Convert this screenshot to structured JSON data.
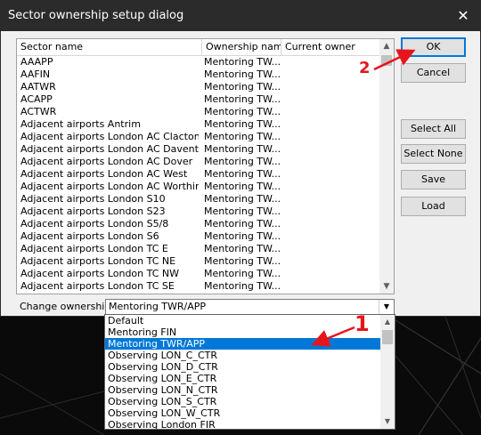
{
  "window": {
    "title": "Sector ownership setup dialog",
    "close_glyph": "✕"
  },
  "list": {
    "headers": [
      "Sector name",
      "Ownership name",
      "Current owner"
    ],
    "rows": [
      {
        "name": "AAAPP",
        "ownership": "Mentoring TW...",
        "owner": ""
      },
      {
        "name": "AAFIN",
        "ownership": "Mentoring TW...",
        "owner": ""
      },
      {
        "name": "AATWR",
        "ownership": "Mentoring TW...",
        "owner": ""
      },
      {
        "name": "ACAPP",
        "ownership": "Mentoring TW...",
        "owner": ""
      },
      {
        "name": "ACTWR",
        "ownership": "Mentoring TW...",
        "owner": ""
      },
      {
        "name": "Adjacent airports Antrim",
        "ownership": "Mentoring TW...",
        "owner": ""
      },
      {
        "name": "Adjacent airports London AC Clacton",
        "ownership": "Mentoring TW...",
        "owner": ""
      },
      {
        "name": "Adjacent airports London AC Daventry",
        "ownership": "Mentoring TW...",
        "owner": ""
      },
      {
        "name": "Adjacent airports London AC Dover",
        "ownership": "Mentoring TW...",
        "owner": ""
      },
      {
        "name": "Adjacent airports London AC West",
        "ownership": "Mentoring TW...",
        "owner": ""
      },
      {
        "name": "Adjacent airports London AC Worthing",
        "ownership": "Mentoring TW...",
        "owner": ""
      },
      {
        "name": "Adjacent airports London S10",
        "ownership": "Mentoring TW...",
        "owner": ""
      },
      {
        "name": "Adjacent airports London S23",
        "ownership": "Mentoring TW...",
        "owner": ""
      },
      {
        "name": "Adjacent airports London S5/8",
        "ownership": "Mentoring TW...",
        "owner": ""
      },
      {
        "name": "Adjacent airports London S6",
        "ownership": "Mentoring TW...",
        "owner": ""
      },
      {
        "name": "Adjacent airports London TC E",
        "ownership": "Mentoring TW...",
        "owner": ""
      },
      {
        "name": "Adjacent airports London TC NE",
        "ownership": "Mentoring TW...",
        "owner": ""
      },
      {
        "name": "Adjacent airports London TC NW",
        "ownership": "Mentoring TW...",
        "owner": ""
      },
      {
        "name": "Adjacent airports London TC SE",
        "ownership": "Mentoring TW...",
        "owner": ""
      }
    ]
  },
  "buttons": {
    "ok": "OK",
    "cancel": "Cancel",
    "select_all": "Select All",
    "select_none": "Select None",
    "save": "Save",
    "load": "Load"
  },
  "change_ownership": {
    "label": "Change ownership",
    "selected": "Mentoring TWR/APP",
    "options": [
      "Default",
      "Mentoring FIN",
      "Mentoring TWR/APP",
      "Observing LON_C_CTR",
      "Observing LON_D_CTR",
      "Observing LON_E_CTR",
      "Observing LON_N_CTR",
      "Observing LON_S_CTR",
      "Observing LON_W_CTR",
      "Observing London FIR"
    ],
    "selected_index": 2
  },
  "annotations": {
    "step1": "1",
    "step2": "2",
    "color": "#e8141b"
  },
  "icons": {
    "scroll_up": "▲",
    "scroll_down": "▼",
    "combo_arrow": "▼"
  }
}
